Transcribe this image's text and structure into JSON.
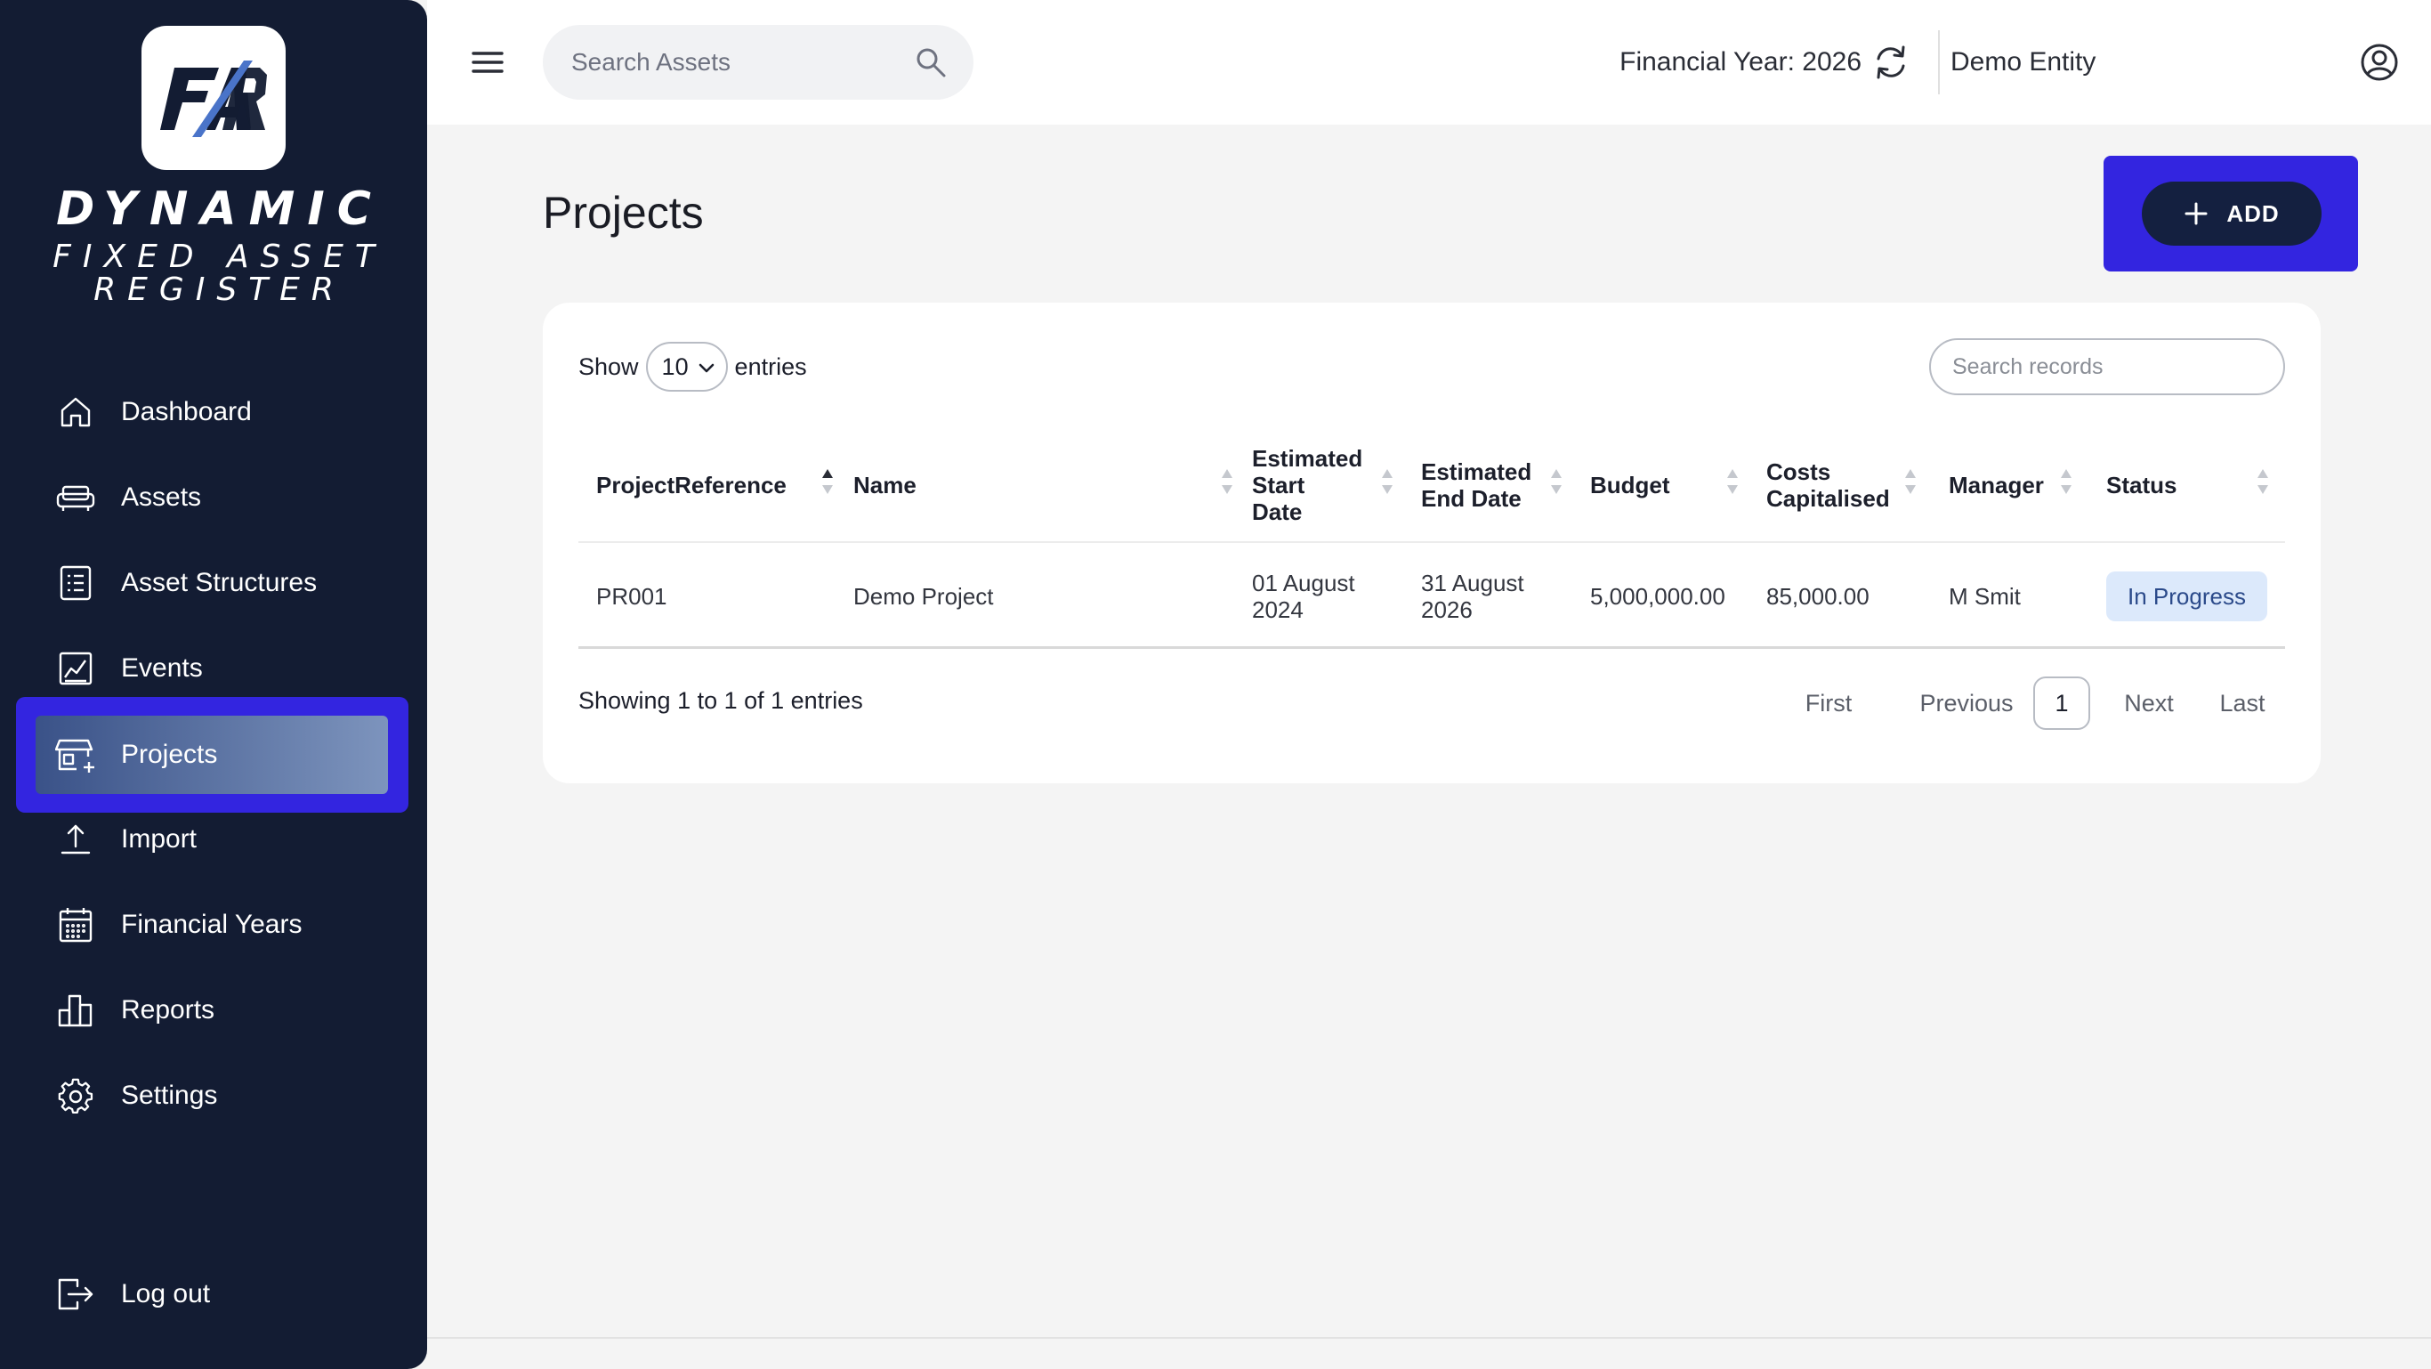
{
  "brand": {
    "logo_text": "FAR",
    "title": "DYNAMIC",
    "subtitle_line1": "FIXED ASSET",
    "subtitle_line2": "REGISTER"
  },
  "sidebar": {
    "items": [
      {
        "label": "Dashboard",
        "icon": "home-icon"
      },
      {
        "label": "Assets",
        "icon": "sofa-icon"
      },
      {
        "label": "Asset Structures",
        "icon": "list-icon"
      },
      {
        "label": "Events",
        "icon": "chart-icon"
      },
      {
        "label": "Projects",
        "icon": "store-add-icon",
        "active": true
      },
      {
        "label": "Import",
        "icon": "upload-icon"
      },
      {
        "label": "Financial Years",
        "icon": "calendar-icon"
      },
      {
        "label": "Reports",
        "icon": "bar-chart-icon"
      },
      {
        "label": "Settings",
        "icon": "gear-icon"
      }
    ],
    "logout": {
      "label": "Log out",
      "icon": "logout-icon"
    }
  },
  "topbar": {
    "search_placeholder": "Search Assets",
    "financial_year": "Financial Year: 2026",
    "entity": "Demo Entity"
  },
  "main": {
    "title": "Projects",
    "add_label": "ADD"
  },
  "table": {
    "show_label": "Show",
    "page_size": "10",
    "entries_label": "entries",
    "search_placeholder": "Search records",
    "columns": [
      "ProjectReference",
      "Name",
      "Estimated Start Date",
      "Estimated End Date",
      "Budget",
      "Costs Capitalised",
      "Manager",
      "Status"
    ],
    "rows": [
      {
        "reference": "PR001",
        "name": "Demo Project",
        "start_date": "01 August 2024",
        "end_date": "31 August 2026",
        "budget": "5,000,000.00",
        "costs_capitalised": "85,000.00",
        "manager": "M Smit",
        "status": "In Progress"
      }
    ],
    "footer_text": "Showing 1 to 1 of 1 entries",
    "pagination": {
      "first": "First",
      "previous": "Previous",
      "current": "1",
      "next": "Next",
      "last": "Last"
    }
  },
  "colors": {
    "sidebar_bg": "#131c33",
    "highlight": "#3325e0",
    "add_button_bg": "#142040",
    "status_badge_bg": "#dce9fb",
    "status_badge_text": "#2b4a8a"
  }
}
